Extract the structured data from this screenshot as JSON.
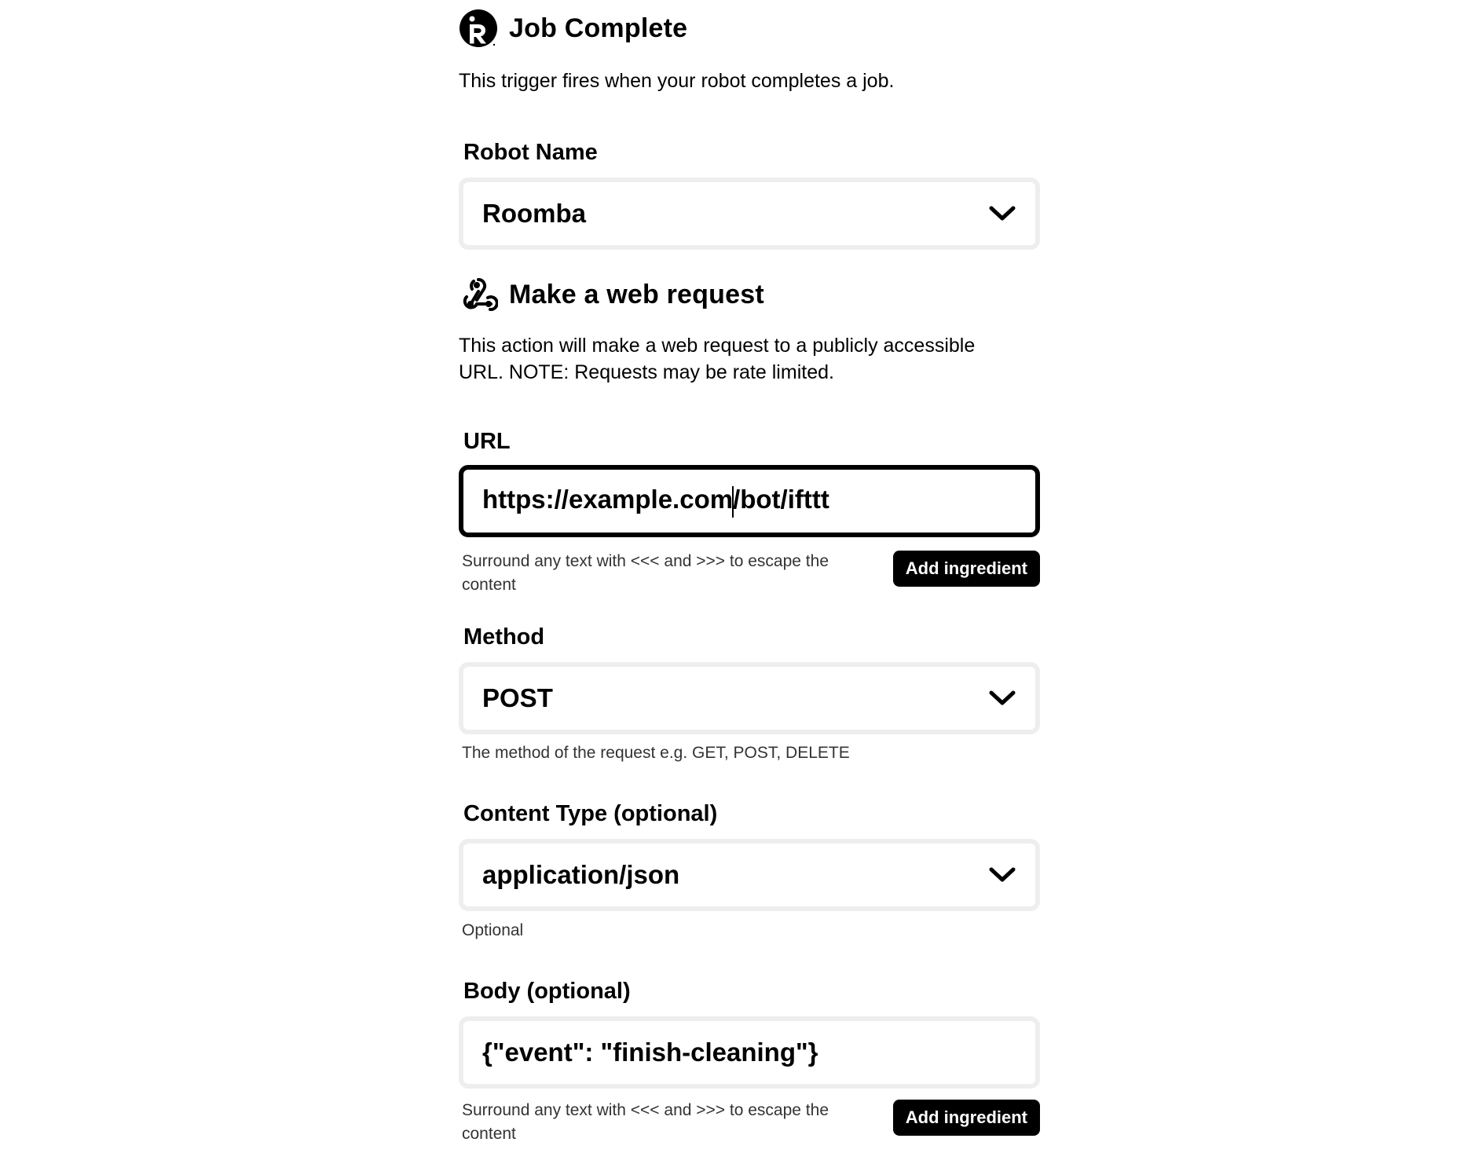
{
  "trigger": {
    "title": "Job Complete",
    "description": "This trigger fires when your robot completes a job.",
    "icon": "irobot-logo-icon",
    "fields": {
      "robot_name": {
        "label": "Robot Name",
        "value": "Roomba"
      }
    }
  },
  "action": {
    "title": "Make a web request",
    "description_line1": "This action will make a web request to a publicly accessible",
    "description_line2": "URL. NOTE: Requests may be rate limited.",
    "icon": "webhooks-icon",
    "fields": {
      "url": {
        "label": "URL",
        "value_before_caret": "https://example.com",
        "value_after_caret": "/bot/ifttt",
        "helper_line1": "Surround any text with <<< and >>> to escape the",
        "helper_line2": "content",
        "button": "Add ingredient"
      },
      "method": {
        "label": "Method",
        "value": "POST",
        "helper": "The method of the request e.g. GET, POST, DELETE"
      },
      "content_type": {
        "label": "Content Type (optional)",
        "value": "application/json",
        "helper": "Optional"
      },
      "body": {
        "label": "Body (optional)",
        "value": "{\"event\": \"finish-cleaning\"}",
        "helper_line1": "Surround any text with <<< and >>> to escape the",
        "helper_line2": "content",
        "button": "Add ingredient"
      }
    }
  },
  "colors": {
    "field_border": "#eeeeee",
    "active_border": "#000000",
    "button_bg": "#000000",
    "button_text": "#ffffff"
  }
}
